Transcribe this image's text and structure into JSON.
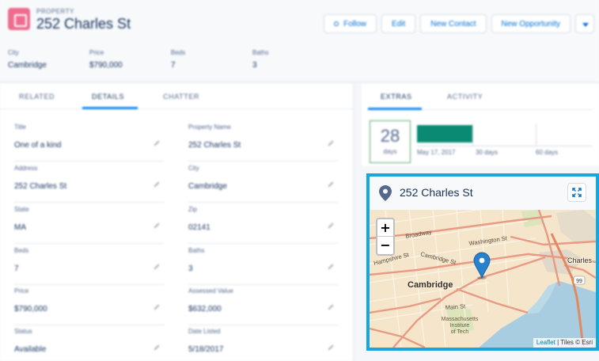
{
  "header": {
    "object_type": "PROPERTY",
    "title": "252 Charles St",
    "actions": [
      "Follow",
      "Edit",
      "New Contact",
      "New Opportunity"
    ]
  },
  "highlights": [
    {
      "label": "City",
      "value": "Cambridge"
    },
    {
      "label": "Price",
      "value": "$790,000"
    },
    {
      "label": "Beds",
      "value": "7"
    },
    {
      "label": "Baths",
      "value": "3"
    }
  ],
  "left_tabs": [
    "RELATED",
    "DETAILS",
    "CHATTER"
  ],
  "details": [
    {
      "label": "Title",
      "value": "One of a kind"
    },
    {
      "label": "Property Name",
      "value": "252 Charles St"
    },
    {
      "label": "Address",
      "value": "252 Charles St"
    },
    {
      "label": "City",
      "value": "Cambridge"
    },
    {
      "label": "State",
      "value": "MA"
    },
    {
      "label": "Zip",
      "value": "02141"
    },
    {
      "label": "Beds",
      "value": "7"
    },
    {
      "label": "Baths",
      "value": "3"
    },
    {
      "label": "Price",
      "value": "$790,000"
    },
    {
      "label": "Assessed Value",
      "value": "$632,000"
    },
    {
      "label": "Status",
      "value": "Available"
    },
    {
      "label": "Date Listed",
      "value": "5/18/2017"
    }
  ],
  "right_tabs": [
    "EXTRAS",
    "ACTIVITY"
  ],
  "timeline": {
    "days_number": "28",
    "days_label": "days",
    "labels": [
      "May 17, 2017",
      "30 days",
      "60 days"
    ]
  },
  "map": {
    "title": "252 Charles St",
    "zoom_in": "+",
    "zoom_out": "−",
    "attribution_link": "Leaflet",
    "attribution_text": "| Tiles © Esri",
    "labels": {
      "cambridge": "Cambridge",
      "charles": "Charles",
      "cambridge_st": "Cambridge St",
      "washington_st": "Washington St",
      "hampshire_st": "Hampshire St",
      "main_st": "Main St",
      "mit": [
        "Massachusetts",
        "Institute",
        "of Tech"
      ],
      "broadway": "Broadway",
      "route": "99"
    }
  },
  "colors": {
    "accent_border": "#16a8dd",
    "progress_fill": "#0a8a72",
    "object_icon": "#ee6b8f"
  }
}
